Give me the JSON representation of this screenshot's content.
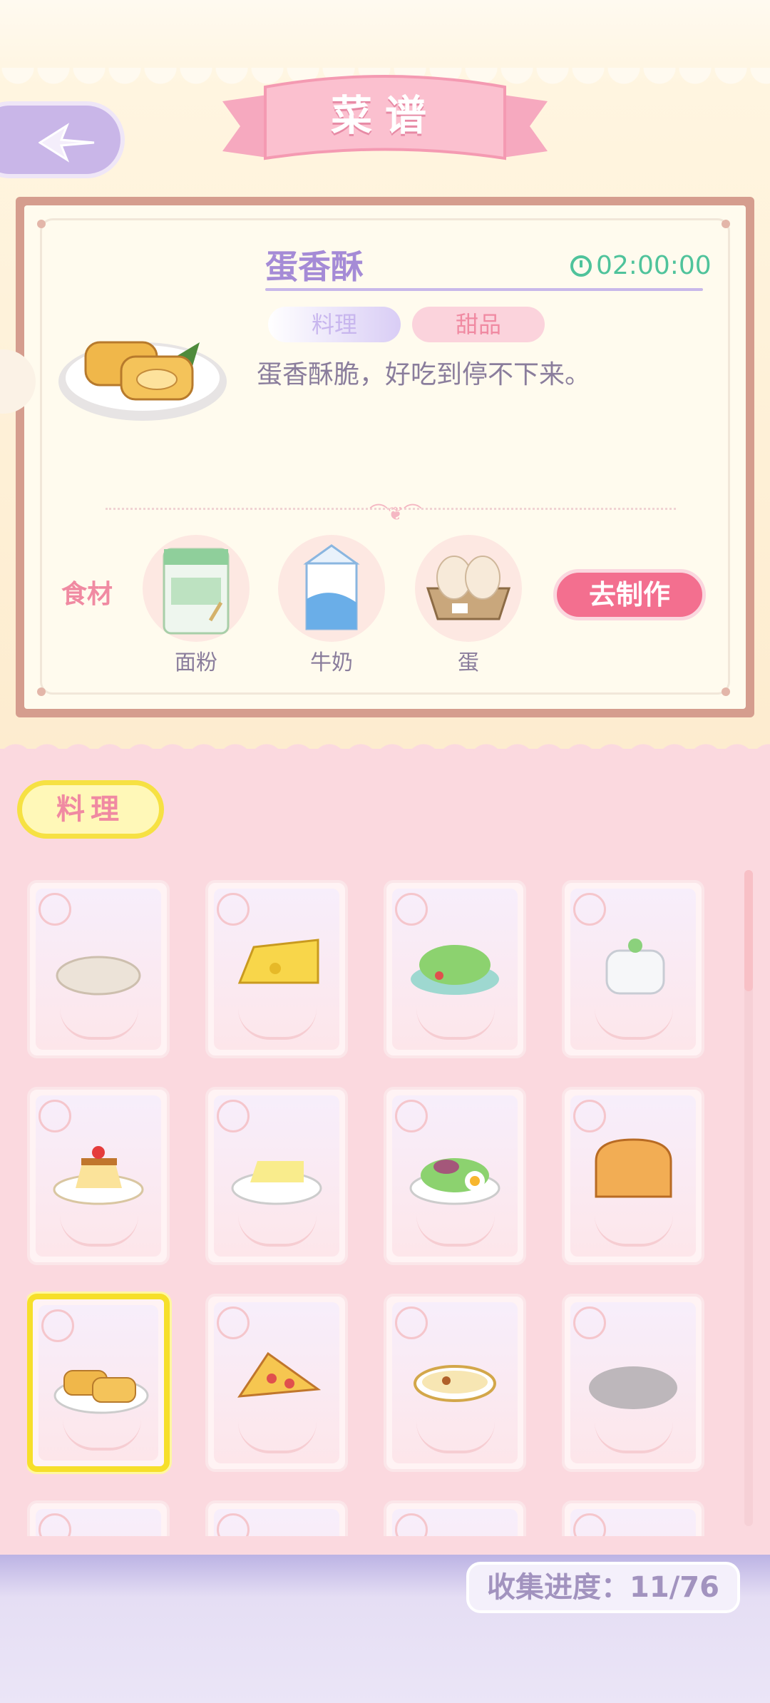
{
  "header": {
    "title": "菜谱"
  },
  "recipe": {
    "name": "蛋香酥",
    "timer": "02:00:00",
    "tags": [
      "料理",
      "甜品"
    ],
    "description": "蛋香酥脆，好吃到停不下来。",
    "ingredients_label": "食材",
    "ingredients": [
      {
        "name": "面粉",
        "icon": "flour-bag-icon"
      },
      {
        "name": "牛奶",
        "icon": "milk-carton-icon"
      },
      {
        "name": "蛋",
        "icon": "egg-carton-icon"
      }
    ],
    "make_button": "去制作"
  },
  "category_tab": "料理",
  "collection_progress": "收集进度：11/76",
  "colors": {
    "accent_pink": "#f36f8f",
    "lavender": "#a58bd6",
    "timer_green": "#4fc39b",
    "selected_gold": "#f6df2a"
  },
  "grid_items": [
    {
      "icon": "flatbread-icon"
    },
    {
      "icon": "cheese-icon"
    },
    {
      "icon": "salad-icon"
    },
    {
      "icon": "yogurt-jar-icon"
    },
    {
      "icon": "pudding-icon"
    },
    {
      "icon": "cheese-plate-icon"
    },
    {
      "icon": "egg-salad-icon"
    },
    {
      "icon": "bread-loaf-icon"
    },
    {
      "icon": "egg-roll-pastry-icon",
      "selected": true
    },
    {
      "icon": "pizza-slice-icon"
    },
    {
      "icon": "soup-bowl-icon"
    },
    {
      "icon": "locked-silhouette-icon"
    }
  ]
}
